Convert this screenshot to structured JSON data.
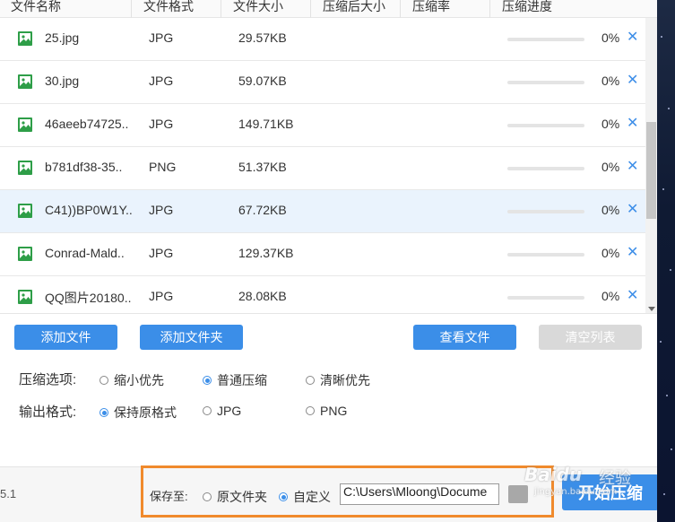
{
  "columns": [
    "文件名称",
    "文件格式",
    "文件大小",
    "压缩后大小",
    "压缩率",
    "压缩进度"
  ],
  "files": [
    {
      "name": "25.jpg",
      "format": "JPG",
      "size": "29.57KB",
      "progress": "0%",
      "progress_value": 0,
      "delete": "✕"
    },
    {
      "name": "30.jpg",
      "format": "JPG",
      "size": "59.07KB",
      "progress": "0%",
      "progress_value": 0,
      "delete": "✕"
    },
    {
      "name": "46aeeb74725..",
      "format": "JPG",
      "size": "149.71KB",
      "progress": "0%",
      "progress_value": 0,
      "delete": "✕"
    },
    {
      "name": "b781df38-35..",
      "format": "PNG",
      "size": "51.37KB",
      "progress": "0%",
      "progress_value": 0,
      "delete": "✕"
    },
    {
      "name": "C41))BP0W1Y..",
      "format": "JPG",
      "size": "67.72KB",
      "progress": "0%",
      "progress_value": 0,
      "delete": "✕"
    },
    {
      "name": "Conrad-Mald..",
      "format": "JPG",
      "size": "129.37KB",
      "progress": "0%",
      "progress_value": 0,
      "delete": "✕"
    },
    {
      "name": "QQ图片20180..",
      "format": "JPG",
      "size": "28.08KB",
      "progress": "0%",
      "progress_value": 0,
      "delete": "✕"
    }
  ],
  "selected_row": 4,
  "buttons": {
    "add_file": "添加文件",
    "add_folder": "添加文件夹",
    "view_files": "查看文件",
    "clear_list": "清空列表",
    "start": "开始压缩"
  },
  "compress_options": {
    "label": "压缩选项:",
    "choices": [
      "缩小优先",
      "普通压缩",
      "清晰优先"
    ],
    "selected": 1
  },
  "output_format": {
    "label": "输出格式:",
    "choices": [
      "保持原格式",
      "JPG",
      "PNG"
    ],
    "selected": 0
  },
  "footer": {
    "version": "5.1",
    "save_to_label": "保存至:",
    "save_choices": [
      "原文件夹",
      "自定义"
    ],
    "save_selected": 1,
    "path": "C:\\Users\\Mloong\\Docume"
  },
  "watermark": {
    "brand": "Baidu",
    "sub": "经验",
    "url": "jingyan.baidu.com"
  },
  "colors": {
    "accent": "#3b8ee8",
    "highlight": "#f08a2c",
    "disabled": "#d9d9d9"
  }
}
